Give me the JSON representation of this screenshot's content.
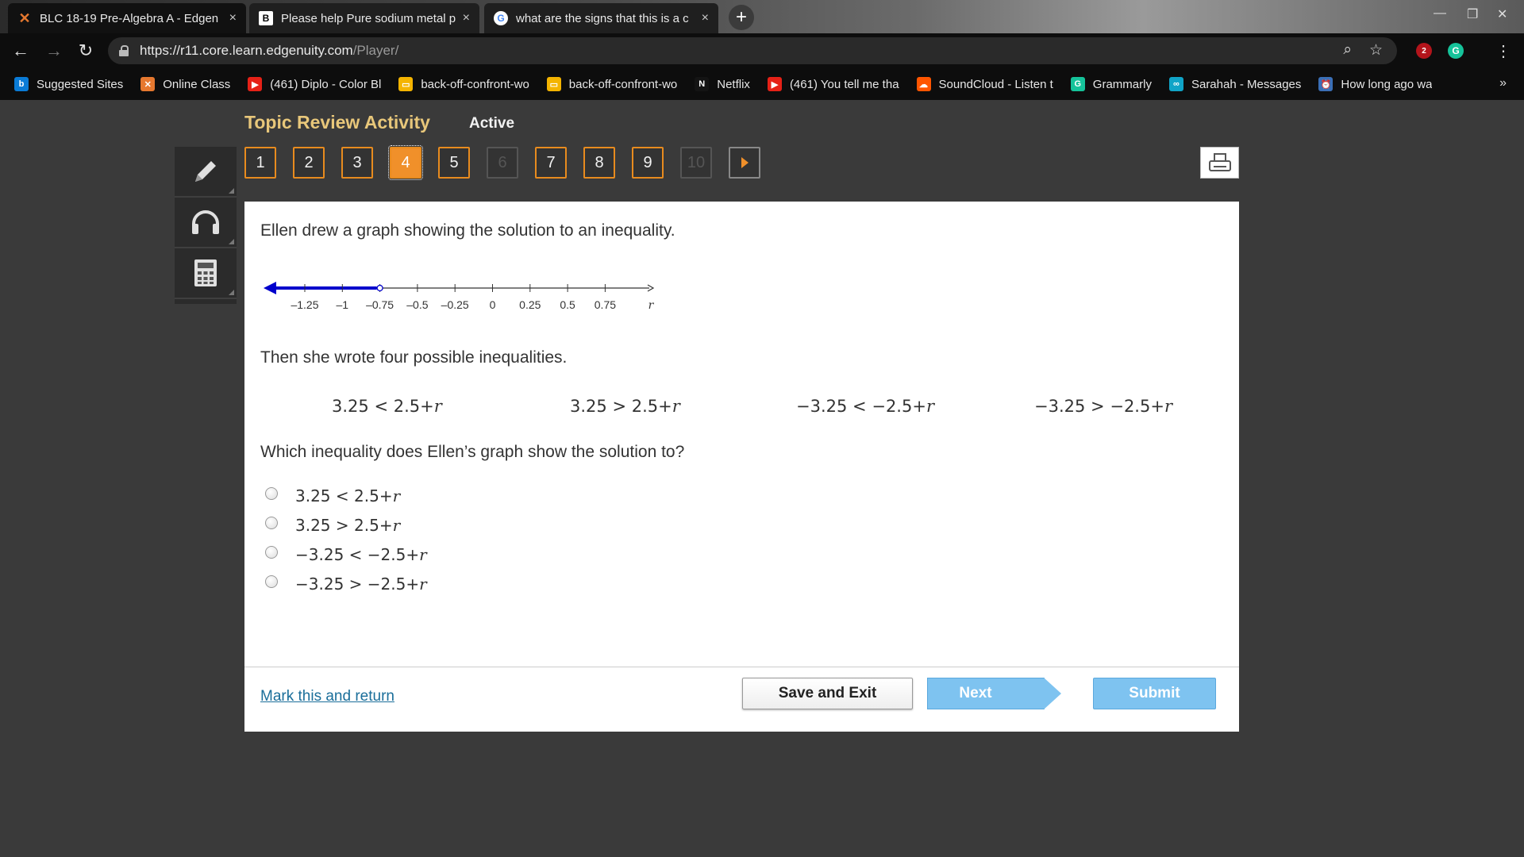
{
  "browser": {
    "tabs": [
      {
        "title": "BLC 18-19 Pre-Algebra A - Edgen",
        "favicon": "edgenuity-x-icon",
        "close": "×"
      },
      {
        "title": "Please help Pure sodium metal p",
        "favicon": "brainly-b-icon",
        "favicon_text": "B",
        "close": "×"
      },
      {
        "title": "what are the signs that this is a c",
        "favicon": "google-g-icon",
        "favicon_text": "G",
        "close": "×"
      }
    ],
    "new_tab": "+",
    "url_host": "https://r11.core.learn.edgenuity.com",
    "url_path": "/Player/",
    "extension_badge": "2",
    "bookmarks": [
      {
        "label": "Suggested Sites",
        "icon": "bing-icon",
        "icon_text": "b",
        "color": "#0a7bd6"
      },
      {
        "label": "Online Class",
        "icon": "edgenuity-x-icon",
        "icon_text": "✕",
        "color": "#e6782f"
      },
      {
        "label": "(461) Diplo - Color Bl",
        "icon": "youtube-icon",
        "icon_text": "▶",
        "color": "#e62117"
      },
      {
        "label": "back-off-confront-wo",
        "icon": "slides-icon",
        "icon_text": "▭",
        "color": "#f4b400"
      },
      {
        "label": "back-off-confront-wo",
        "icon": "slides-icon",
        "icon_text": "▭",
        "color": "#f4b400"
      },
      {
        "label": "Netflix",
        "icon": "netflix-icon",
        "icon_text": "N",
        "color": "#141414"
      },
      {
        "label": "(461) You tell me tha",
        "icon": "youtube-icon",
        "icon_text": "▶",
        "color": "#e62117"
      },
      {
        "label": "SoundCloud - Listen t",
        "icon": "soundcloud-icon",
        "icon_text": "☁",
        "color": "#ff5500"
      },
      {
        "label": "Grammarly",
        "icon": "grammarly-icon",
        "icon_text": "G",
        "color": "#15c39a"
      },
      {
        "label": "Sarahah - Messages",
        "icon": "sarahah-icon",
        "icon_text": "∞",
        "color": "#10a4c7"
      },
      {
        "label": "How long ago wa",
        "icon": "clock-icon",
        "icon_text": "⏰",
        "color": "#3b6fb6"
      }
    ],
    "bookmarks_more": "»"
  },
  "player": {
    "activity_title": "Topic Review Activity",
    "status": "Active",
    "question_numbers": [
      "1",
      "2",
      "3",
      "4",
      "5",
      "6",
      "7",
      "8",
      "9",
      "10"
    ],
    "current_question": "4",
    "disabled_questions": [
      "6",
      "10"
    ]
  },
  "question": {
    "intro": "Ellen drew a graph showing the solution to an inequality.",
    "number_line": {
      "tick_labels": [
        "–1.25",
        "–1",
        "–0.75",
        "–0.5",
        "–0.25",
        "0",
        "0.25",
        "0.5",
        "0.75"
      ],
      "variable": "r",
      "ray_color": "#0000cc",
      "open_circle_at": "–0.75"
    },
    "middle": "Then she wrote four possible inequalities.",
    "inequalities": [
      {
        "lhs": "3.25",
        "op": "<",
        "rhs": "2.5+",
        "var": "r"
      },
      {
        "lhs": "3.25",
        "op": ">",
        "rhs": "2.5+",
        "var": "r"
      },
      {
        "lhs": "−3.25",
        "op": "<",
        "rhs": "−2.5+",
        "var": "r"
      },
      {
        "lhs": "−3.25",
        "op": ">",
        "rhs": "−2.5+",
        "var": "r"
      }
    ],
    "prompt": "Which inequality does Ellen’s graph show the solution to?",
    "options": [
      {
        "lhs": "3.25",
        "op": "<",
        "rhs": "2.5+",
        "var": "r"
      },
      {
        "lhs": "3.25",
        "op": ">",
        "rhs": "2.5+",
        "var": "r"
      },
      {
        "lhs": "−3.25",
        "op": "<",
        "rhs": "−2.5+",
        "var": "r"
      },
      {
        "lhs": "−3.25",
        "op": ">",
        "rhs": "−2.5+",
        "var": "r"
      }
    ]
  },
  "footer": {
    "mark_link": "Mark this and return",
    "save_label": "Save and Exit",
    "next_label": "Next",
    "submit_label": "Submit"
  }
}
